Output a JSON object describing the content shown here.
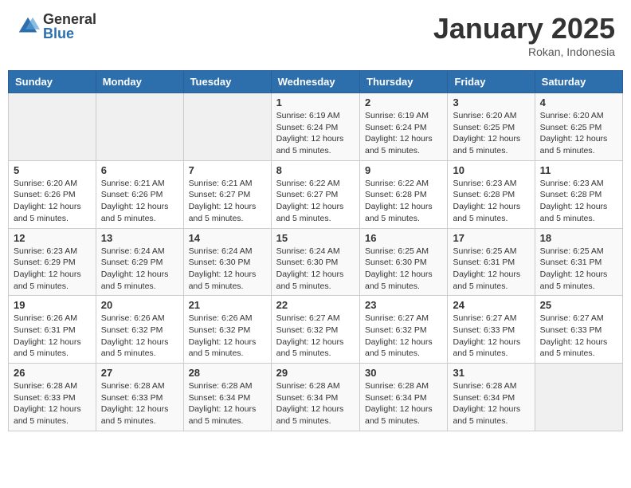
{
  "header": {
    "logo_general": "General",
    "logo_blue": "Blue",
    "month": "January 2025",
    "location": "Rokan, Indonesia"
  },
  "days_of_week": [
    "Sunday",
    "Monday",
    "Tuesday",
    "Wednesday",
    "Thursday",
    "Friday",
    "Saturday"
  ],
  "weeks": [
    [
      {
        "day": "",
        "info": ""
      },
      {
        "day": "",
        "info": ""
      },
      {
        "day": "",
        "info": ""
      },
      {
        "day": "1",
        "info": "Sunrise: 6:19 AM\nSunset: 6:24 PM\nDaylight: 12 hours and 5 minutes."
      },
      {
        "day": "2",
        "info": "Sunrise: 6:19 AM\nSunset: 6:24 PM\nDaylight: 12 hours and 5 minutes."
      },
      {
        "day": "3",
        "info": "Sunrise: 6:20 AM\nSunset: 6:25 PM\nDaylight: 12 hours and 5 minutes."
      },
      {
        "day": "4",
        "info": "Sunrise: 6:20 AM\nSunset: 6:25 PM\nDaylight: 12 hours and 5 minutes."
      }
    ],
    [
      {
        "day": "5",
        "info": "Sunrise: 6:20 AM\nSunset: 6:26 PM\nDaylight: 12 hours and 5 minutes."
      },
      {
        "day": "6",
        "info": "Sunrise: 6:21 AM\nSunset: 6:26 PM\nDaylight: 12 hours and 5 minutes."
      },
      {
        "day": "7",
        "info": "Sunrise: 6:21 AM\nSunset: 6:27 PM\nDaylight: 12 hours and 5 minutes."
      },
      {
        "day": "8",
        "info": "Sunrise: 6:22 AM\nSunset: 6:27 PM\nDaylight: 12 hours and 5 minutes."
      },
      {
        "day": "9",
        "info": "Sunrise: 6:22 AM\nSunset: 6:28 PM\nDaylight: 12 hours and 5 minutes."
      },
      {
        "day": "10",
        "info": "Sunrise: 6:23 AM\nSunset: 6:28 PM\nDaylight: 12 hours and 5 minutes."
      },
      {
        "day": "11",
        "info": "Sunrise: 6:23 AM\nSunset: 6:28 PM\nDaylight: 12 hours and 5 minutes."
      }
    ],
    [
      {
        "day": "12",
        "info": "Sunrise: 6:23 AM\nSunset: 6:29 PM\nDaylight: 12 hours and 5 minutes."
      },
      {
        "day": "13",
        "info": "Sunrise: 6:24 AM\nSunset: 6:29 PM\nDaylight: 12 hours and 5 minutes."
      },
      {
        "day": "14",
        "info": "Sunrise: 6:24 AM\nSunset: 6:30 PM\nDaylight: 12 hours and 5 minutes."
      },
      {
        "day": "15",
        "info": "Sunrise: 6:24 AM\nSunset: 6:30 PM\nDaylight: 12 hours and 5 minutes."
      },
      {
        "day": "16",
        "info": "Sunrise: 6:25 AM\nSunset: 6:30 PM\nDaylight: 12 hours and 5 minutes."
      },
      {
        "day": "17",
        "info": "Sunrise: 6:25 AM\nSunset: 6:31 PM\nDaylight: 12 hours and 5 minutes."
      },
      {
        "day": "18",
        "info": "Sunrise: 6:25 AM\nSunset: 6:31 PM\nDaylight: 12 hours and 5 minutes."
      }
    ],
    [
      {
        "day": "19",
        "info": "Sunrise: 6:26 AM\nSunset: 6:31 PM\nDaylight: 12 hours and 5 minutes."
      },
      {
        "day": "20",
        "info": "Sunrise: 6:26 AM\nSunset: 6:32 PM\nDaylight: 12 hours and 5 minutes."
      },
      {
        "day": "21",
        "info": "Sunrise: 6:26 AM\nSunset: 6:32 PM\nDaylight: 12 hours and 5 minutes."
      },
      {
        "day": "22",
        "info": "Sunrise: 6:27 AM\nSunset: 6:32 PM\nDaylight: 12 hours and 5 minutes."
      },
      {
        "day": "23",
        "info": "Sunrise: 6:27 AM\nSunset: 6:32 PM\nDaylight: 12 hours and 5 minutes."
      },
      {
        "day": "24",
        "info": "Sunrise: 6:27 AM\nSunset: 6:33 PM\nDaylight: 12 hours and 5 minutes."
      },
      {
        "day": "25",
        "info": "Sunrise: 6:27 AM\nSunset: 6:33 PM\nDaylight: 12 hours and 5 minutes."
      }
    ],
    [
      {
        "day": "26",
        "info": "Sunrise: 6:28 AM\nSunset: 6:33 PM\nDaylight: 12 hours and 5 minutes."
      },
      {
        "day": "27",
        "info": "Sunrise: 6:28 AM\nSunset: 6:33 PM\nDaylight: 12 hours and 5 minutes."
      },
      {
        "day": "28",
        "info": "Sunrise: 6:28 AM\nSunset: 6:34 PM\nDaylight: 12 hours and 5 minutes."
      },
      {
        "day": "29",
        "info": "Sunrise: 6:28 AM\nSunset: 6:34 PM\nDaylight: 12 hours and 5 minutes."
      },
      {
        "day": "30",
        "info": "Sunrise: 6:28 AM\nSunset: 6:34 PM\nDaylight: 12 hours and 5 minutes."
      },
      {
        "day": "31",
        "info": "Sunrise: 6:28 AM\nSunset: 6:34 PM\nDaylight: 12 hours and 5 minutes."
      },
      {
        "day": "",
        "info": ""
      }
    ]
  ]
}
